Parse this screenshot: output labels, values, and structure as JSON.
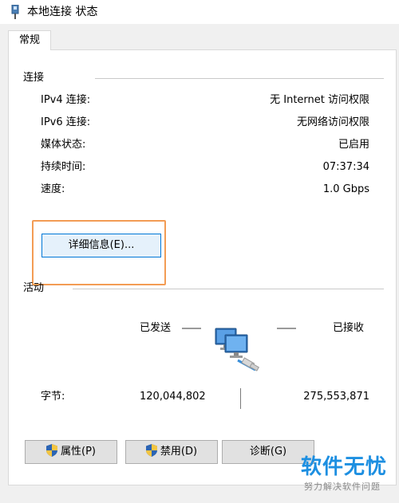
{
  "window": {
    "title": "本地连接 状态",
    "title_icon": "network-adapter-icon"
  },
  "tabs": [
    {
      "label": "常规"
    }
  ],
  "connection": {
    "group_label": "连接",
    "rows": [
      {
        "label": "IPv4 连接:",
        "value": "无 Internet 访问权限"
      },
      {
        "label": "IPv6 连接:",
        "value": "无网络访问权限"
      },
      {
        "label": "媒体状态:",
        "value": "已启用"
      },
      {
        "label": "持续时间:",
        "value": "07:37:34"
      },
      {
        "label": "速度:",
        "value": "1.0 Gbps"
      }
    ],
    "details_button": "详细信息(E)..."
  },
  "activity": {
    "group_label": "活动",
    "sent_label": "已发送",
    "received_label": "已接收",
    "bytes_label": "字节:",
    "bytes_sent": "120,044,802",
    "bytes_received": "275,553,871",
    "icon": "network-computers-icon"
  },
  "buttons": {
    "properties": "属性(P)",
    "disable": "禁用(D)",
    "diagnose": "诊断(G)"
  },
  "watermark": {
    "main": "软件无忧",
    "sub": "努力解决软件问题"
  },
  "colors": {
    "highlight_border": "#f39c54",
    "focus_button_border": "#0078d7",
    "watermark": "#1d8fe1"
  }
}
